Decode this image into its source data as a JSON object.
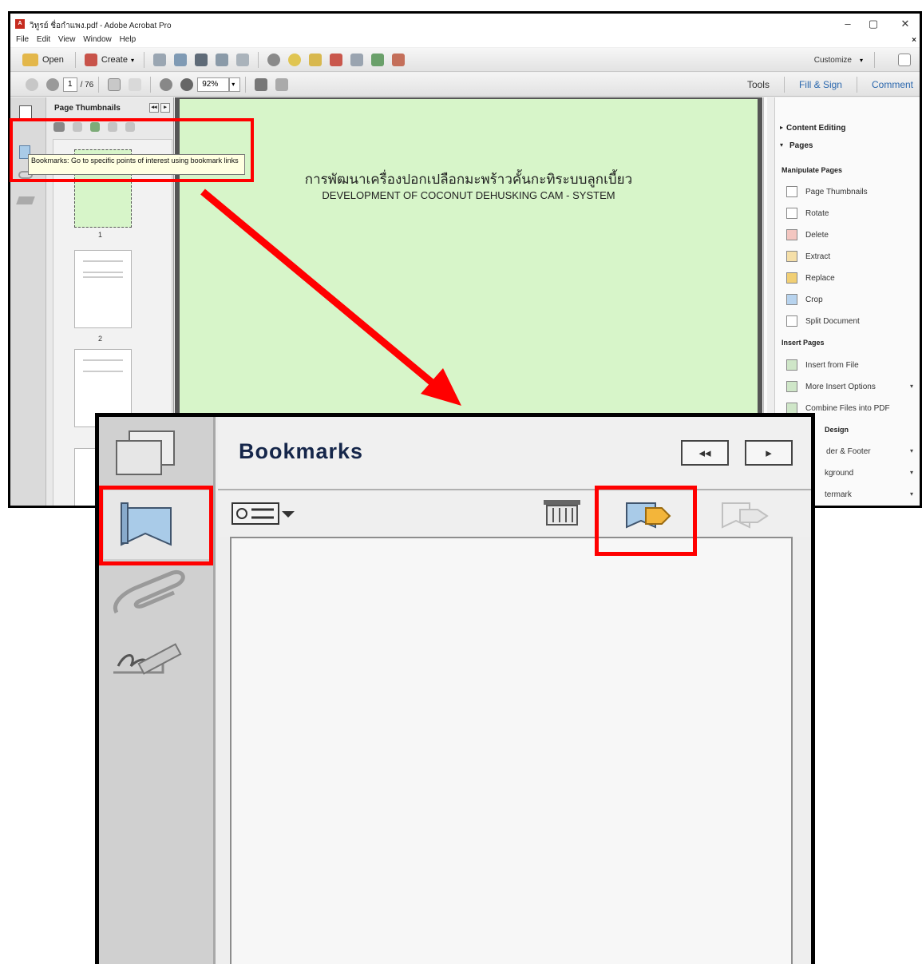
{
  "window": {
    "title": "วิทูรย์ ชื่อกำแพง.pdf - Adobe Acrobat Pro",
    "menu": [
      "File",
      "Edit",
      "View",
      "Window",
      "Help"
    ],
    "controls": [
      "–",
      "▢",
      "✕"
    ],
    "menu_close": "×"
  },
  "toolbar1": {
    "open_label": "Open",
    "create_label": "Create",
    "customize_label": "Customize"
  },
  "toolbar2": {
    "page_current": "1",
    "page_total": "/ 76",
    "zoom": "92%",
    "tabs": [
      "Tools",
      "Fill & Sign",
      "Comment"
    ]
  },
  "thumbnails_panel": {
    "title": "Page Thumbnails",
    "page_labels": [
      "1",
      "2"
    ]
  },
  "tooltip": {
    "text": "Bookmarks: Go to specific points of interest using bookmark links"
  },
  "document": {
    "title_thai": "การพัฒนาเครื่องปอกเปลือกมะพร้าวคั้นกะทิระบบลูกเบี้ยว",
    "title_english": "DEVELOPMENT OF COCONUT DEHUSKING CAM - SYSTEM"
  },
  "right_pane": {
    "content_editing": "Content Editing",
    "pages": "Pages",
    "manipulate_pages": "Manipulate Pages",
    "manipulate_items": [
      "Page Thumbnails",
      "Rotate",
      "Delete",
      "Extract",
      "Replace",
      "Crop",
      "Split Document"
    ],
    "insert_pages": "Insert Pages",
    "insert_items": [
      "Insert from File",
      "More Insert Options",
      "Combine Files into PDF"
    ],
    "design_label": "Design",
    "design_items": [
      "der & Footer",
      "kground",
      "termark"
    ]
  },
  "zoom_panel": {
    "title": "Bookmarks"
  },
  "colors": {
    "highlight": "#ff0000",
    "page_bg": "#d7f5c9",
    "bookmark_blue": "#a9cbe8"
  }
}
